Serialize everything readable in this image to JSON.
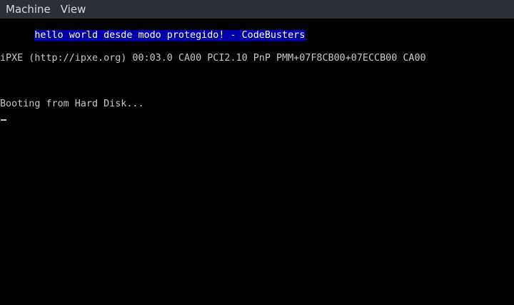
{
  "menu": {
    "items": [
      {
        "label": "Machine"
      },
      {
        "label": "View"
      }
    ]
  },
  "console": {
    "banner": "hello world desde modo protegido! - CodeBusters",
    "ipxe_line": "iPXE (http://ipxe.org) 00:03.0 CA00 PCI2.10 PnP PMM+07F8CB00+07ECCB00 CA00",
    "boot_line": "Booting from Hard Disk...",
    "banner_bg": "#0000a8",
    "text_color": "#c8c8c8"
  }
}
